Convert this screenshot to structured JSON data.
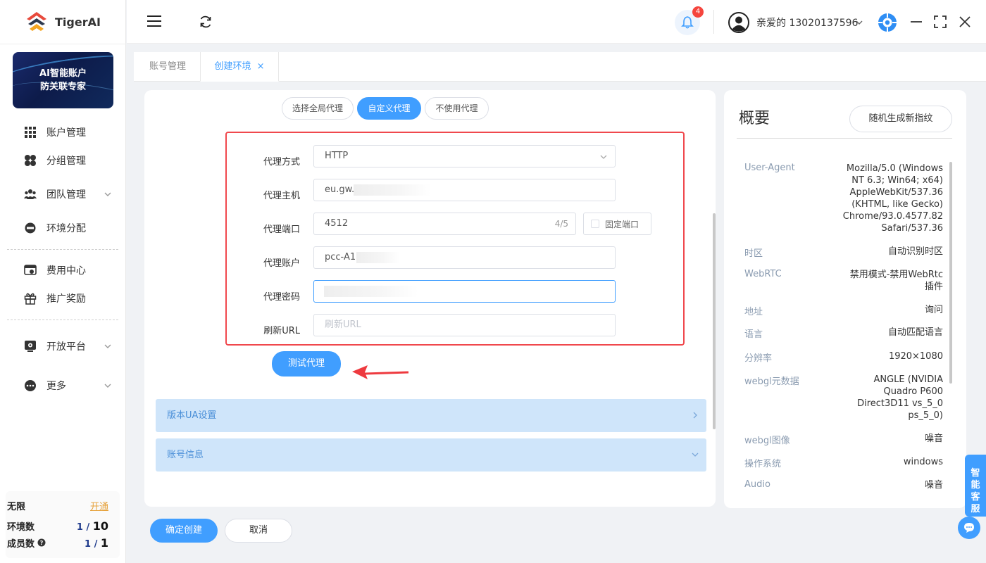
{
  "app": {
    "name": "TigerAI"
  },
  "banner": {
    "line1": "AI智能账户",
    "line2": "防关联专家"
  },
  "sidebar": {
    "items": [
      {
        "label": "账户管理",
        "icon": "grid-icon"
      },
      {
        "label": "分组管理",
        "icon": "clover-icon"
      },
      {
        "label": "团队管理",
        "icon": "team-icon"
      },
      {
        "label": "环境分配",
        "icon": "env-icon"
      },
      {
        "label": "费用中心",
        "icon": "billing-icon"
      },
      {
        "label": "推广奖励",
        "icon": "gift-icon"
      },
      {
        "label": "开放平台",
        "icon": "open-platform-icon"
      },
      {
        "label": "更多",
        "icon": "more-icon"
      }
    ]
  },
  "plan": {
    "tier": "无限",
    "upgrade": "开通",
    "env_label": "环境数",
    "env_used": "1 /",
    "env_total": "10",
    "members_label": "成员数",
    "members_used": "1 /",
    "members_total": "1"
  },
  "header": {
    "notification_count": "4",
    "user": "亲爱的 13020137596"
  },
  "tabs": [
    {
      "label": "账号管理",
      "active": false
    },
    {
      "label": "创建环境",
      "active": true,
      "close": "×"
    }
  ],
  "proxy_mode": {
    "options": [
      "选择全局代理",
      "自定义代理",
      "不使用代理"
    ],
    "selected": "自定义代理"
  },
  "form": {
    "type_label": "代理方式",
    "type_value": "HTTP",
    "host_label": "代理主机",
    "host_value": "eu.gw.",
    "port_label": "代理端口",
    "port_value": "4512",
    "port_counter": "4/5",
    "fixed_port": "固定端口",
    "account_label": "代理账户",
    "account_value": "pcc-A12",
    "password_label": "代理密码",
    "password_value": "",
    "refresh_label": "刷新URL",
    "refresh_placeholder": "刷新URL"
  },
  "buttons": {
    "test": "测试代理",
    "confirm": "确定创建",
    "cancel": "取消"
  },
  "sections": [
    {
      "label": "版本UA设置"
    },
    {
      "label": "账号信息"
    }
  ],
  "overview": {
    "title": "概要",
    "regen": "随机生成新指纹",
    "rows": [
      {
        "key": "User-Agent",
        "value": [
          "Mozilla/5.0 (Windows",
          "NT 6.3; Win64; x64)",
          "AppleWebKit/537.36",
          "(KHTML, like Gecko)",
          "Chrome/93.0.4577.82",
          "Safari/537.36"
        ]
      },
      {
        "key": "时区",
        "value": [
          "自动识别时区"
        ]
      },
      {
        "key": "WebRTC",
        "value": [
          "禁用模式-禁用WebRtc",
          "插件"
        ]
      },
      {
        "key": "地址",
        "value": [
          "询问"
        ]
      },
      {
        "key": "语言",
        "value": [
          "自动匹配语言"
        ]
      },
      {
        "key": "分辨率",
        "value": [
          "1920×1080"
        ]
      },
      {
        "key": "webgl元数据",
        "value": [
          "ANGLE (NVIDIA",
          "Quadro P600",
          "Direct3D11 vs_5_0",
          "ps_5_0)"
        ]
      },
      {
        "key": "webgl图像",
        "value": [
          "噪音"
        ]
      },
      {
        "key": "操作系统",
        "value": [
          "windows"
        ]
      },
      {
        "key": "Audio",
        "value": [
          "噪音"
        ]
      }
    ]
  },
  "support": {
    "label": "智能客服"
  },
  "colors": {
    "primary": "#409eff",
    "danger": "#f0484d",
    "collapse_bg": "#cfe5fa"
  }
}
